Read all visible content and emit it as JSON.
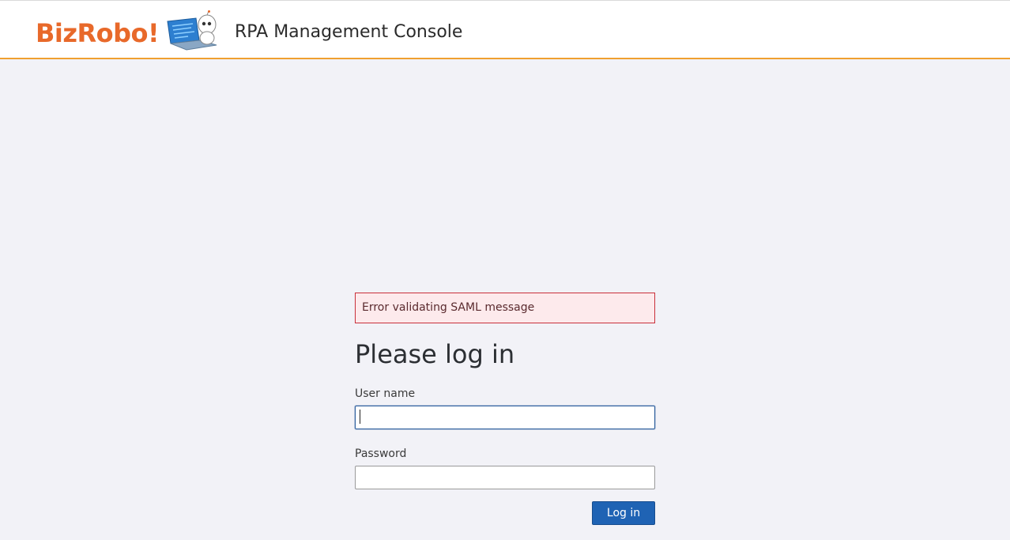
{
  "header": {
    "logo_text": "BizRobo!",
    "app_title": "RPA Management Console",
    "accent_color": "#f0a030",
    "brand_color": "#e8692a"
  },
  "alert": {
    "message": "Error validating SAML message",
    "type": "error"
  },
  "login": {
    "heading": "Please log in",
    "username": {
      "label": "User name",
      "value": "",
      "placeholder": ""
    },
    "password": {
      "label": "Password",
      "value": "",
      "placeholder": ""
    },
    "submit_label": "Log in",
    "button_color": "#1f63b4"
  }
}
